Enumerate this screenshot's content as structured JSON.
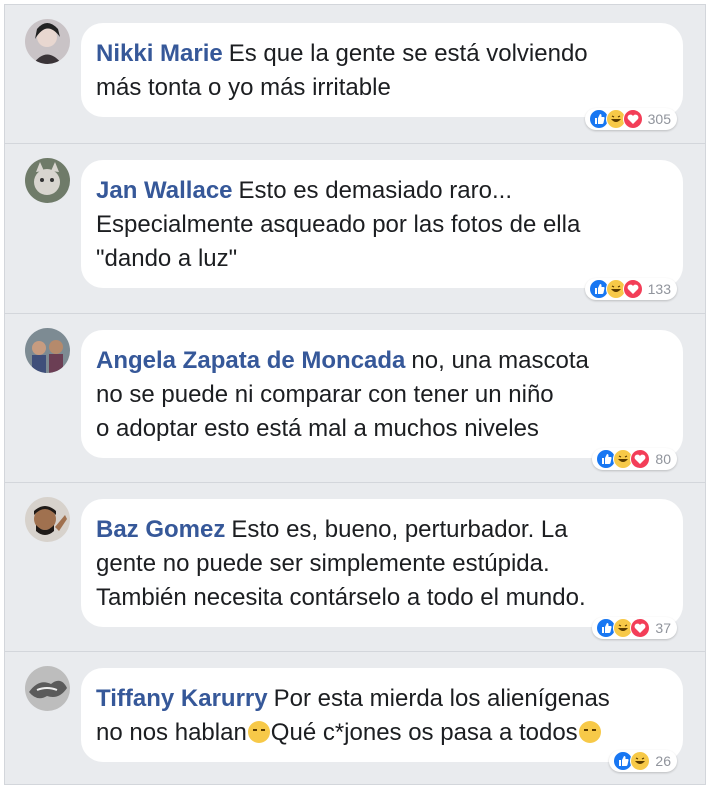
{
  "comments": [
    {
      "name": "Nikki Marie",
      "text": "Es que la gente se está volviendo\nmás tonta o yo más irritable",
      "reactions": [
        "like",
        "haha",
        "love"
      ],
      "count": "305"
    },
    {
      "name": "Jan Wallace",
      "text": "Esto es demasiado raro...\nEspecialmente asqueado por las fotos de ella\n\"dando a luz\"",
      "reactions": [
        "like",
        "haha",
        "love"
      ],
      "count": "133"
    },
    {
      "name": "Angela Zapata de Moncada",
      "text": "no, una mascota\nno se puede ni comparar con tener un niño\no adoptar esto está mal a muchos niveles",
      "reactions": [
        "like",
        "haha",
        "love"
      ],
      "count": "80"
    },
    {
      "name": "Baz Gomez",
      "text": "Esto es, bueno, perturbador. La\ngente no puede ser simplemente estúpida.\nTambién necesita contárselo a todo el mundo.",
      "reactions": [
        "like",
        "haha",
        "love"
      ],
      "count": "37"
    },
    {
      "name": "Tiffany Karurry",
      "text_a": "Por esta mierda los alienígenas\nno nos hablan",
      "text_b": "Qué c*jones os pasa a todos",
      "reactions": [
        "like",
        "haha"
      ],
      "count": "26"
    }
  ],
  "colors": {
    "name": "#365899",
    "like": "#1877f2",
    "haha": "#f7c948",
    "love": "#f33e58",
    "background": "#e9ebee"
  },
  "emoji_icon": "unamused-face-icon"
}
